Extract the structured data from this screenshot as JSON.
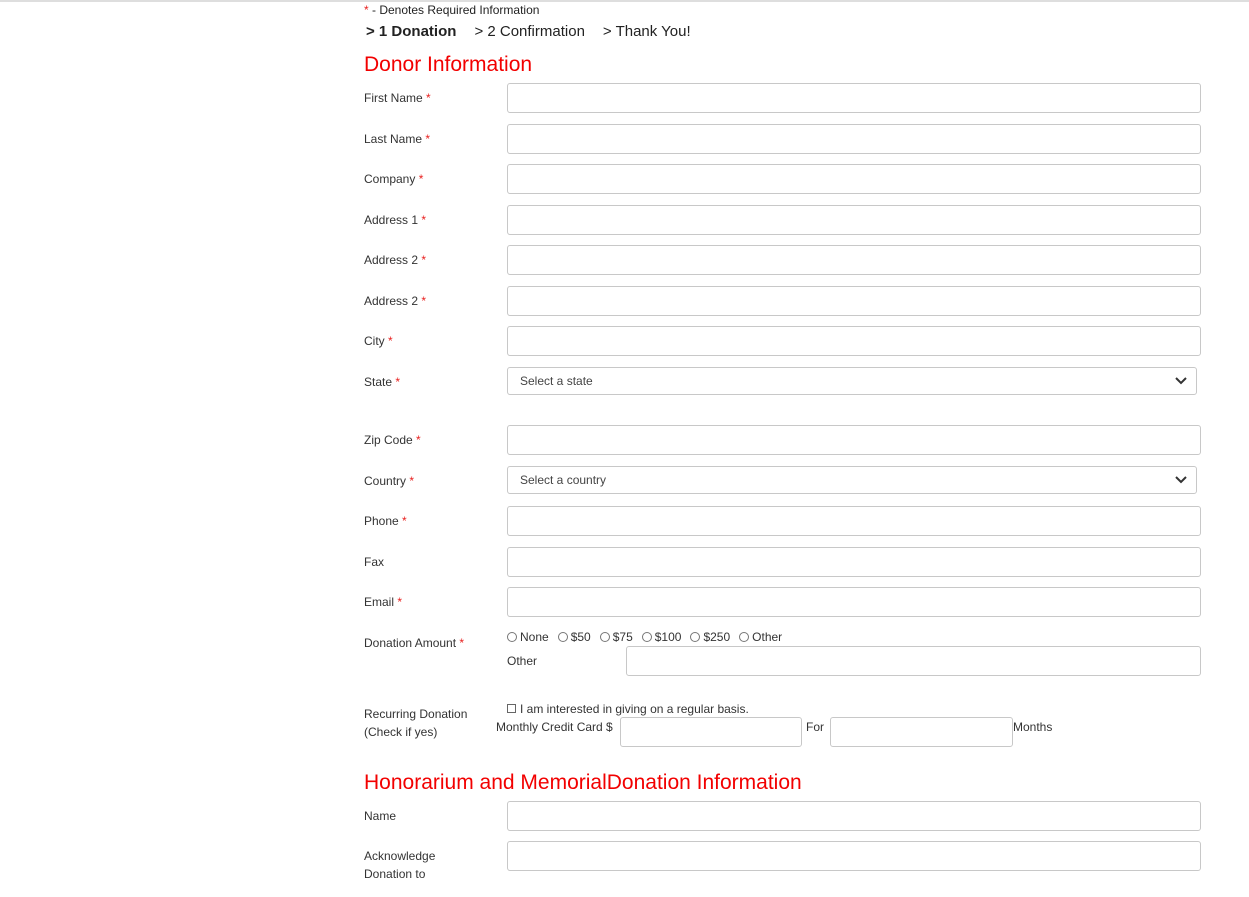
{
  "header": {
    "required_star": "*",
    "required_note": " - Denotes Required Information",
    "steps": [
      {
        "label": "> 1 Donation"
      },
      {
        "label": "> 2 Confirmation"
      },
      {
        "label": "> Thank You!"
      }
    ]
  },
  "donor": {
    "title": "Donor Information",
    "first_name": {
      "label": "First Name",
      "star": "*",
      "value": ""
    },
    "last_name": {
      "label": "Last Name",
      "star": "*",
      "value": ""
    },
    "company": {
      "label": "Company",
      "star": "*",
      "value": ""
    },
    "address1": {
      "label": "Address 1",
      "star": "*",
      "value": ""
    },
    "address2a": {
      "label": "Address 2",
      "star": "*",
      "value": ""
    },
    "address2b": {
      "label": "Address 2",
      "star": "*",
      "value": ""
    },
    "city": {
      "label": "City",
      "star": "*",
      "value": ""
    },
    "state": {
      "label": "State",
      "star": "*",
      "selected": "Select a state"
    },
    "zip": {
      "label": "Zip Code",
      "star": "*",
      "value": ""
    },
    "country": {
      "label": "Country",
      "star": "*",
      "selected": "Select a country"
    },
    "phone": {
      "label": "Phone",
      "star": "*",
      "value": ""
    },
    "fax": {
      "label": "Fax",
      "value": ""
    },
    "email": {
      "label": "Email",
      "star": "*",
      "value": ""
    },
    "donation_amount": {
      "label": "Donation Amount",
      "star": "*",
      "options": [
        "None",
        "$50",
        "$75",
        "$100",
        "$250",
        "Other"
      ],
      "other_label": "Other",
      "other_value": ""
    },
    "recurring": {
      "label_line1": "Recurring Donation",
      "label_line2": "(Check if yes)",
      "checkbox_label": "I am interested in giving on a regular basis.",
      "monthly_label": "Monthly Credit Card $",
      "for_label": "For",
      "months_label": "Months"
    }
  },
  "honorarium": {
    "title": "Honorarium and MemorialDonation Information",
    "name": {
      "label": "Name",
      "value": ""
    },
    "acknowledge": {
      "label_line1": "Acknowledge",
      "label_line2": "Donation to",
      "value": ""
    }
  },
  "colors": {
    "accent_red": "#f20000",
    "required_star": "#e8201f",
    "input_border": "#c8c8c8"
  },
  "icons": {
    "select_arrow": "chevron-down-icon"
  }
}
